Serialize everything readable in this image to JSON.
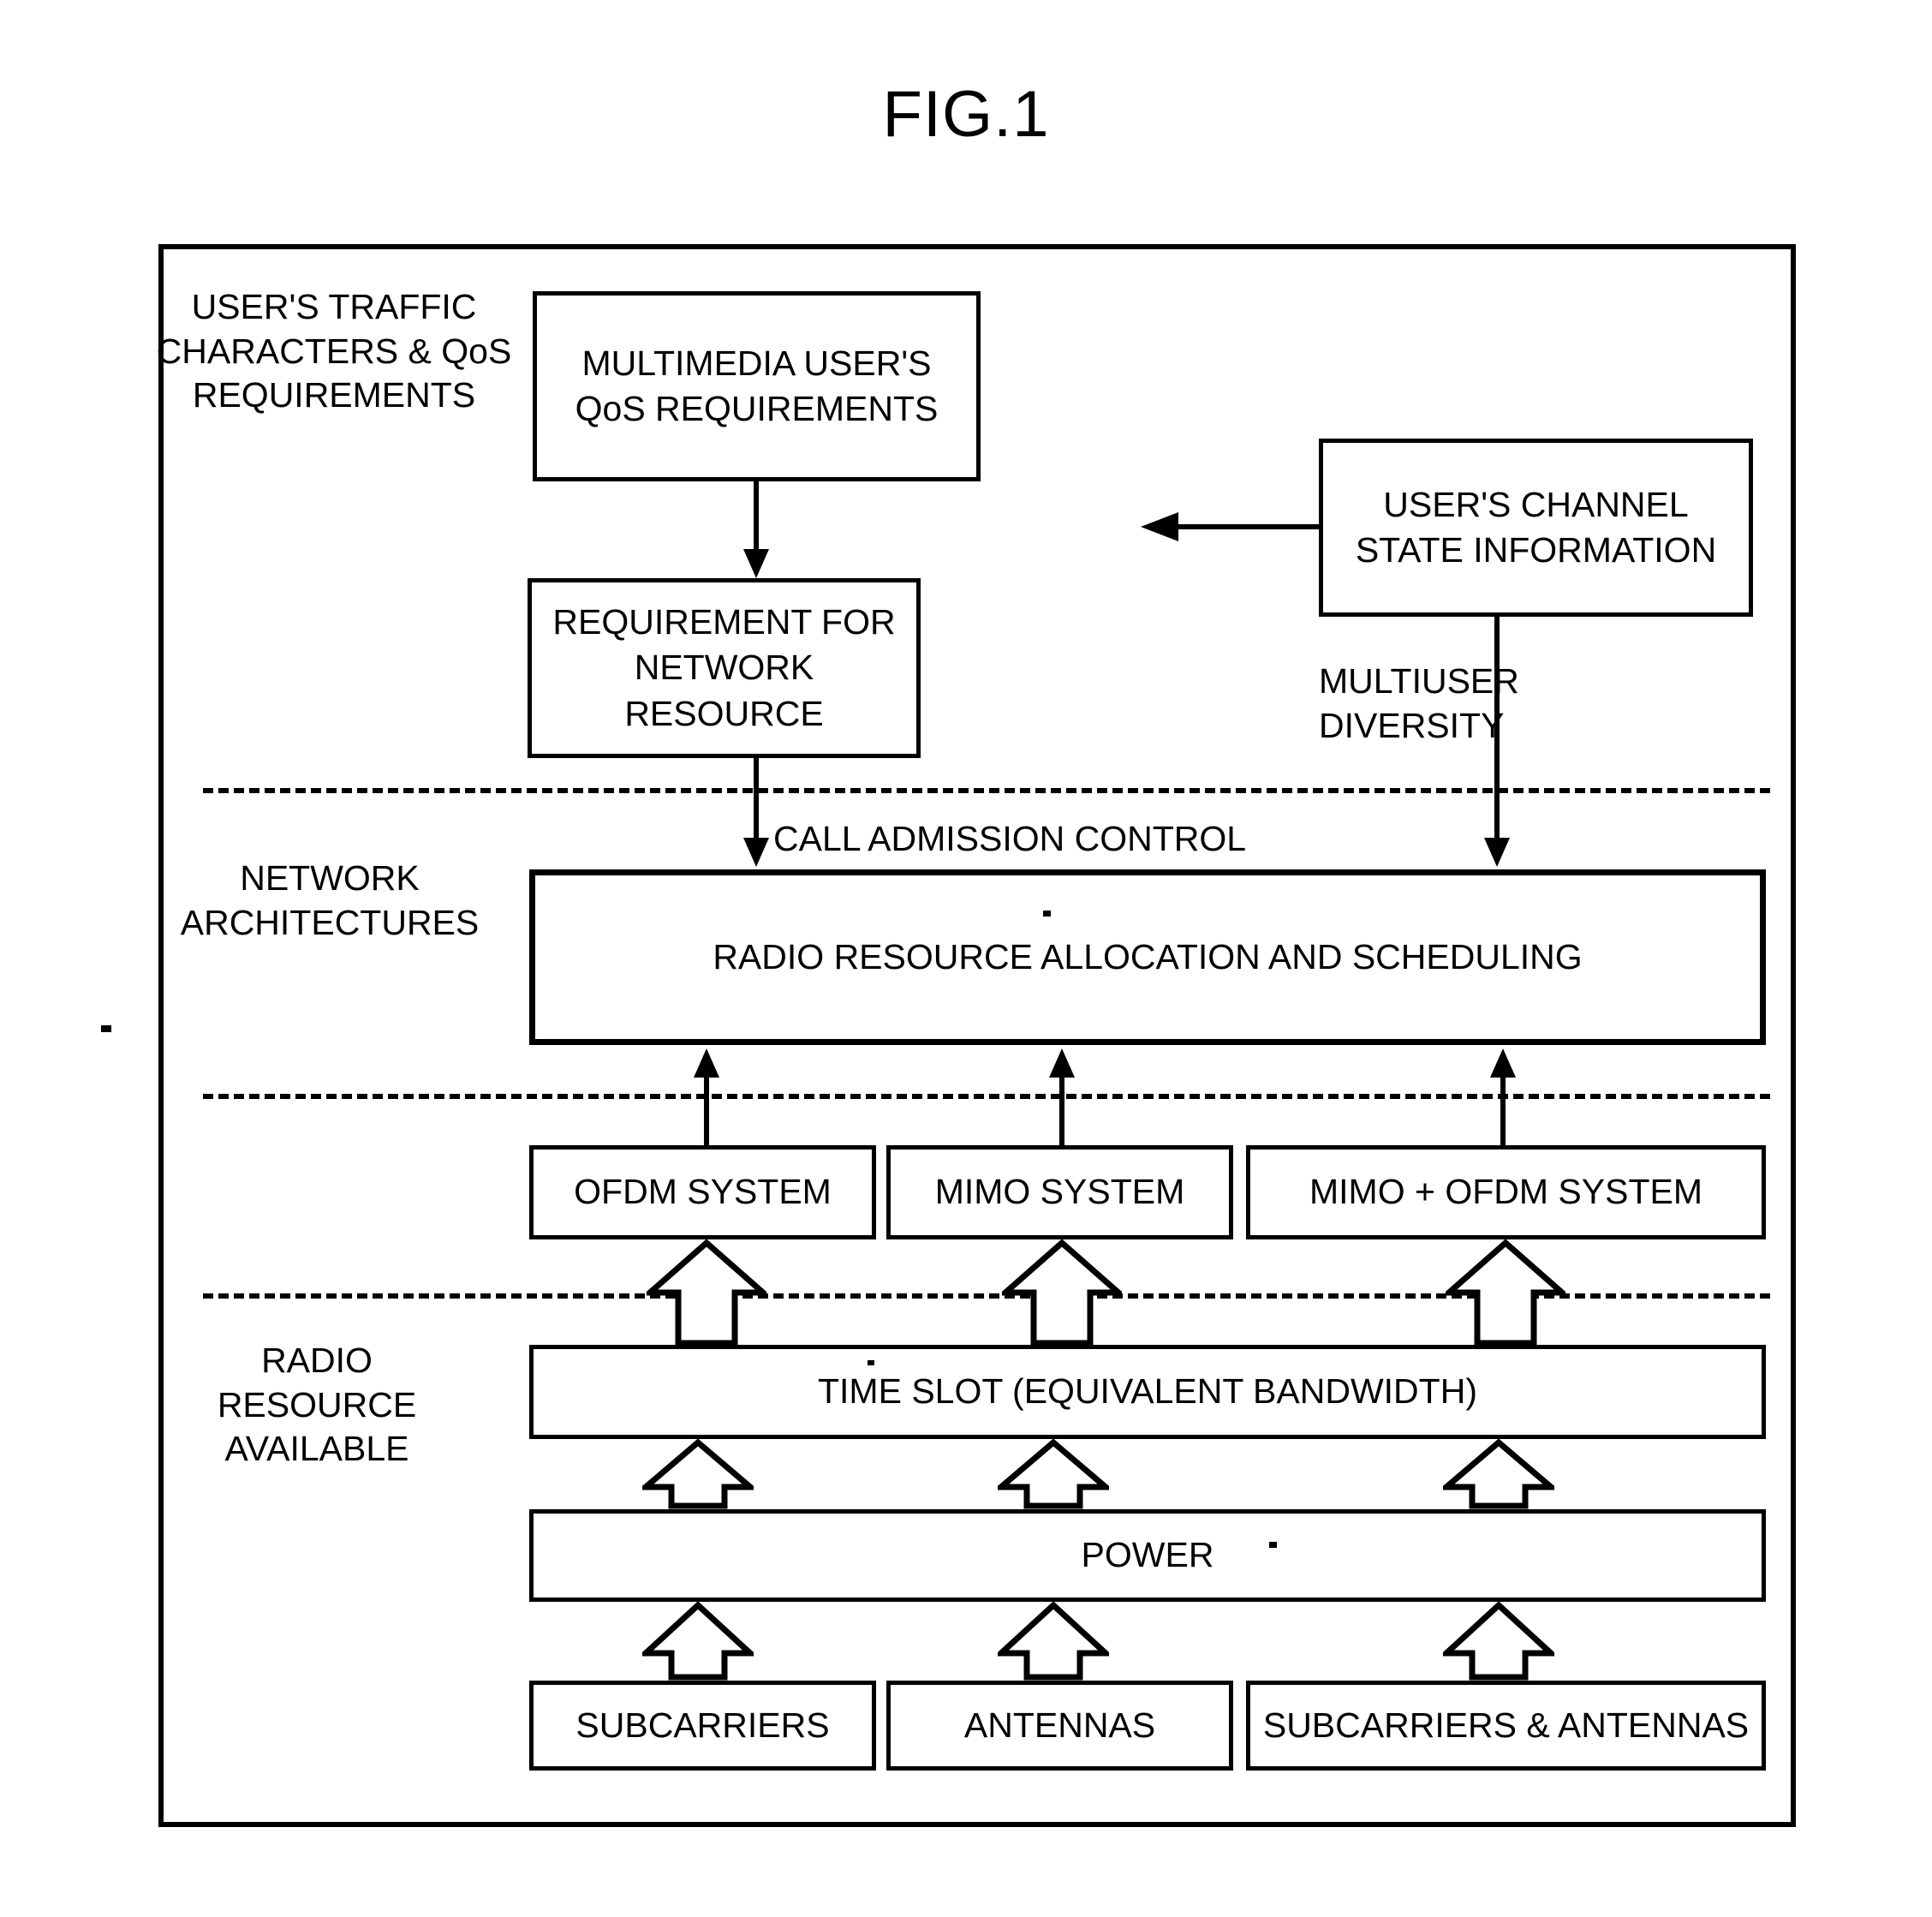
{
  "figure": {
    "title": "FIG.1"
  },
  "side_labels": [
    {
      "id": "users-traffic",
      "text": "USER'S TRAFFIC\nCHARACTERS & QoS\nREQUIREMENTS"
    },
    {
      "id": "network-architectures",
      "text": "NETWORK\nARCHITECTURES"
    },
    {
      "id": "radio-resource-available",
      "text": "RADIO\nRESOURCE\nAVAILABLE"
    }
  ],
  "boxes": {
    "multimedia_qos": "MULTIMEDIA USER'S\nQoS REQUIREMENTS",
    "requirement_network_resource": "REQUIREMENT FOR\nNETWORK RESOURCE",
    "user_channel_state": "USER'S CHANNEL\nSTATE INFORMATION",
    "radio_resource_allocation": "RADIO RESOURCE ALLOCATION AND SCHEDULING",
    "ofdm_system": "OFDM SYSTEM",
    "mimo_system": "MIMO SYSTEM",
    "mimo_ofdm_system": "MIMO + OFDM SYSTEM",
    "time_slot": "TIME SLOT (EQUIVALENT BANDWIDTH)",
    "power": "POWER",
    "subcarriers": "SUBCARRIERS",
    "antennas": "ANTENNAS",
    "subcarriers_antennas": "SUBCARRIERS & ANTENNAS"
  },
  "annotations": {
    "multiuser_diversity": "MULTIUSER\nDIVERSITY",
    "call_admission_control": "CALL ADMISSION CONTROL"
  },
  "colors": {
    "line": "#000000",
    "background": "#ffffff"
  }
}
